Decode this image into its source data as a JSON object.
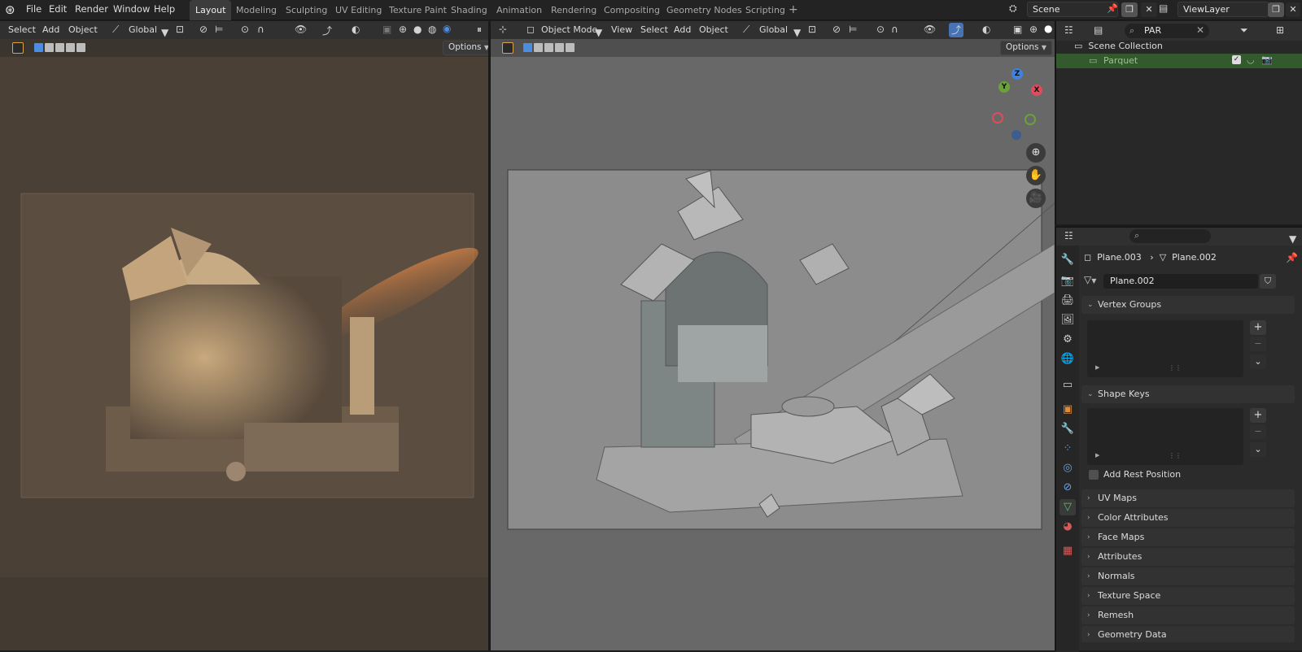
{
  "menus": [
    "File",
    "Edit",
    "Render",
    "Window",
    "Help"
  ],
  "workspaces": [
    "Layout",
    "Modeling",
    "Sculpting",
    "UV Editing",
    "Texture Paint",
    "Shading",
    "Animation",
    "Rendering",
    "Compositing",
    "Geometry Nodes",
    "Scripting"
  ],
  "active_workspace": "Layout",
  "add_workspace": "+",
  "scene": {
    "name": "Scene"
  },
  "view_layer": {
    "name": "ViewLayer"
  },
  "left_view": {
    "menu": [
      "Select",
      "Add",
      "Object"
    ],
    "orientation": "Global",
    "options": "Options"
  },
  "right_view": {
    "mode": "Object Mode",
    "menu": [
      "View",
      "Select",
      "Add",
      "Object"
    ],
    "orientation": "Global",
    "options": "Options",
    "gizmo": {
      "z": "Z",
      "y": "Y",
      "x": "X"
    }
  },
  "outliner": {
    "search_value": "PAR",
    "collection": "Scene Collection",
    "item": "Parquet"
  },
  "properties": {
    "breadcrumb_object": "Plane.003",
    "breadcrumb_data": "Plane.002",
    "data_name": "Plane.002",
    "vertex_groups": "Vertex Groups",
    "shape_keys": "Shape Keys",
    "add_rest_position": "Add Rest Position",
    "panels": [
      "UV Maps",
      "Color Attributes",
      "Face Maps",
      "Attributes",
      "Normals",
      "Texture Space",
      "Remesh",
      "Geometry Data"
    ]
  },
  "colors": {
    "accent": "#4772b3",
    "outliner_highlight": "#335a2d",
    "render_bg": "#4a4036",
    "viewport_bg": "#6b6b6b"
  }
}
